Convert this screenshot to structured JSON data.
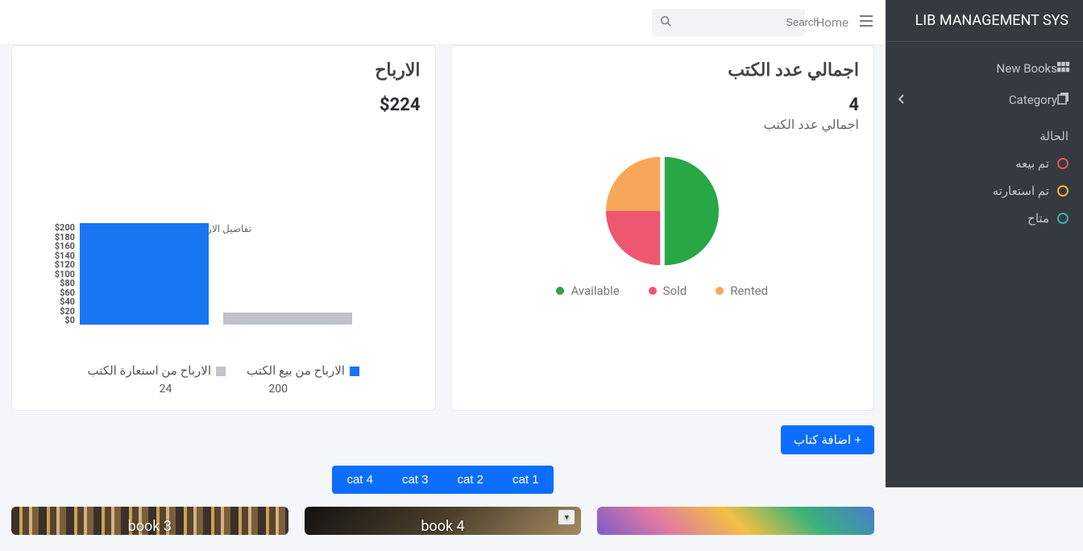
{
  "brand": "LIB MANAGEMENT SYS",
  "sidebar": {
    "new_books": "New Books",
    "category": "Category",
    "status_heading": "الحالة",
    "statuses": {
      "sold": "تم بيعه",
      "rented": "تم استعارته",
      "available": "متاح"
    }
  },
  "topbar": {
    "search_placeholder": "Search",
    "home": "Home"
  },
  "totals_card": {
    "title": "اجمالي عدد الكتب",
    "value": "4",
    "subtitle": "اجمالي عدد الكتب",
    "legend": {
      "available": "Available",
      "sold": "Sold",
      "rented": "Rented"
    }
  },
  "profits_card": {
    "title": "الارباح",
    "amount": "$224",
    "x_axis_title": "تفاصيل الارباح",
    "legend": {
      "sales": "الارباح من بيع الكتب",
      "rentals": "الارباح من استعارة الكتب"
    },
    "sales_value": "200",
    "rentals_value": "24",
    "y_ticks": [
      "$200",
      "$180",
      "$160",
      "$140",
      "$120",
      "$100",
      "$80",
      "$60",
      "$40",
      "$20",
      "$0"
    ]
  },
  "actions": {
    "add_book": "+ اضافة كتاب"
  },
  "cats": [
    "cat 4",
    "cat 3",
    "cat 2",
    "cat 1"
  ],
  "books": {
    "b1_title": "",
    "b2_title": "book 4",
    "b3_title": "book 3"
  },
  "chart_data": [
    {
      "type": "pie",
      "title": "اجمالي عدد الكتب",
      "series": [
        {
          "name": "Available",
          "value": 2,
          "color": "#28a745"
        },
        {
          "name": "Sold",
          "value": 1,
          "color": "#ef5671"
        },
        {
          "name": "Rented",
          "value": 1,
          "color": "#f7a759"
        }
      ]
    },
    {
      "type": "bar",
      "title": "الارباح",
      "xlabel": "تفاصيل الارباح",
      "ylabel": "$",
      "ylim": [
        0,
        200
      ],
      "categories": [
        "تفاصيل الارباح"
      ],
      "series": [
        {
          "name": "الارباح من بيع الكتب",
          "values": [
            200
          ],
          "color": "#1976f2"
        },
        {
          "name": "الارباح من استعارة الكتب",
          "values": [
            24
          ],
          "color": "#c0c3c8"
        }
      ]
    }
  ]
}
